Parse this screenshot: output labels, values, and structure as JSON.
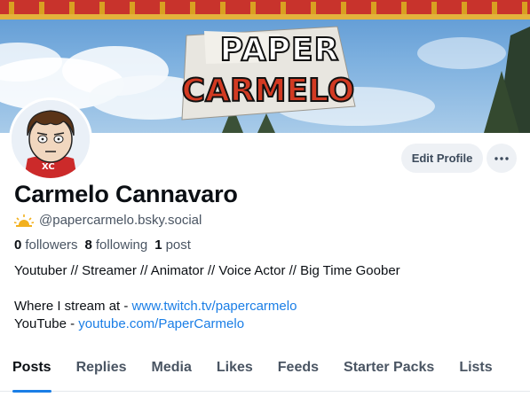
{
  "profile": {
    "display_name": "Carmelo Cannavaro",
    "handle": "@papercarmelo.bsky.social",
    "banner_logo_line1": "PAPER",
    "banner_logo_line2": "CARMELO",
    "avatar_shirt_text": "XC",
    "followers_count": "0",
    "followers_label": "followers",
    "following_count": "8",
    "following_label": "following",
    "posts_count": "1",
    "posts_label": "post"
  },
  "actions": {
    "edit_profile_label": "Edit Profile",
    "more_icon": "ellipsis-icon"
  },
  "bio": {
    "line1": "Youtuber // Streamer // Animator // Voice Actor // Big Time Goober",
    "stream_prefix": "Where I stream at - ",
    "stream_link": "www.twitch.tv/papercarmelo",
    "youtube_prefix": "YouTube - ",
    "youtube_link": "youtube.com/PaperCarmelo"
  },
  "tabs": [
    {
      "label": "Posts",
      "active": true
    },
    {
      "label": "Replies",
      "active": false
    },
    {
      "label": "Media",
      "active": false
    },
    {
      "label": "Likes",
      "active": false
    },
    {
      "label": "Feeds",
      "active": false
    },
    {
      "label": "Starter Packs",
      "active": false
    },
    {
      "label": "Lists",
      "active": false
    }
  ],
  "colors": {
    "accent": "#1a7ee6",
    "text": "#0b0f14",
    "muted": "#4a5563",
    "button_bg": "#eef1f5"
  }
}
